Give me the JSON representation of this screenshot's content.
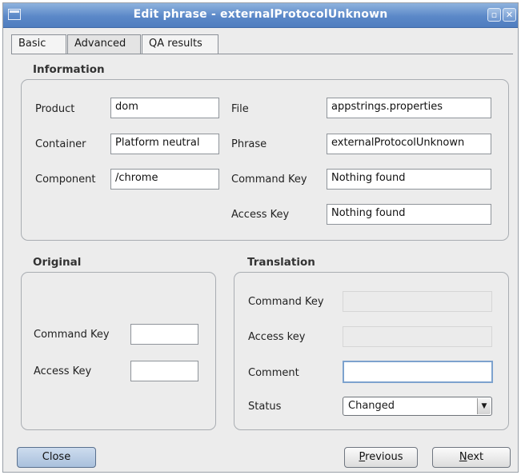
{
  "window": {
    "title": "Edit phrase - externalProtocolUnknown"
  },
  "tabs": [
    {
      "label": "Basic"
    },
    {
      "label": "Advanced"
    },
    {
      "label": "QA results"
    }
  ],
  "information": {
    "title": "Information",
    "product_label": "Product",
    "product_value": "dom",
    "container_label": "Container",
    "container_value": "Platform neutral",
    "component_label": "Component",
    "component_value": "/chrome",
    "file_label": "File",
    "file_value": "appstrings.properties",
    "phrase_label": "Phrase",
    "phrase_value": "externalProtocolUnknown",
    "command_key_label": "Command Key",
    "command_key_value": "Nothing found",
    "access_key_label": "Access Key",
    "access_key_value": "Nothing found"
  },
  "original": {
    "title": "Original",
    "command_key_label": "Command Key",
    "command_key_value": "",
    "access_key_label": "Access Key",
    "access_key_value": ""
  },
  "translation": {
    "title": "Translation",
    "command_key_label": "Command Key",
    "command_key_value": "",
    "access_key_label": "Access key",
    "access_key_value": "",
    "comment_label": "Comment",
    "comment_value": "",
    "status_label": "Status",
    "status_value": "Changed"
  },
  "buttons": {
    "close_label": "Close",
    "previous_mnemonic": "P",
    "previous_rest": "revious",
    "next_mnemonic": "N",
    "next_rest": "ext"
  },
  "icons": {
    "window": "window-icon",
    "maximize": "maximize-icon",
    "close": "close-icon",
    "dropdown": "chevron-down-icon"
  }
}
